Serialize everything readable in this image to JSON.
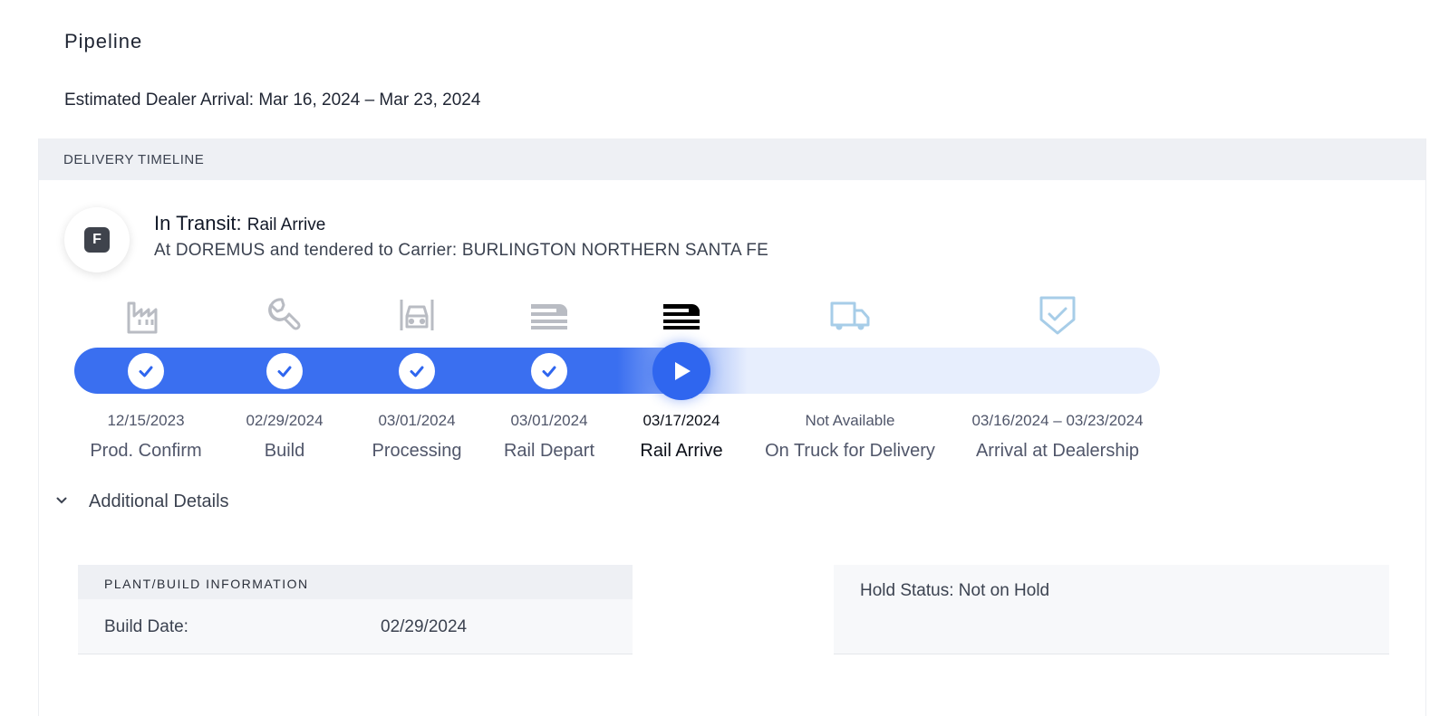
{
  "page": {
    "title": "Pipeline",
    "estimated_arrival": "Estimated Dealer Arrival: Mar 16, 2024 – Mar 23, 2024"
  },
  "timeline": {
    "header": "DELIVERY TIMELINE",
    "badge_letter": "F",
    "status_title": "In Transit:",
    "status_substep": "Rail Arrive",
    "status_description": "At DOREMUS and tendered to Carrier: BURLINGTON NORTHERN SANTA FE",
    "current_step_index": 4,
    "steps": [
      {
        "date": "12/15/2023",
        "label": "Prod. Confirm",
        "icon": "factory-icon",
        "state": "complete"
      },
      {
        "date": "02/29/2024",
        "label": "Build",
        "icon": "wrench-icon",
        "state": "complete"
      },
      {
        "date": "03/01/2024",
        "label": "Processing",
        "icon": "car-front-icon",
        "state": "complete"
      },
      {
        "date": "03/01/2024",
        "label": "Rail Depart",
        "icon": "train-icon",
        "state": "complete"
      },
      {
        "date": "03/17/2024",
        "label": "Rail Arrive",
        "icon": "train-icon",
        "state": "current"
      },
      {
        "date": "Not Available",
        "label": "On Truck for Delivery",
        "icon": "truck-icon",
        "state": "pending"
      },
      {
        "date": "03/16/2024 – 03/23/2024",
        "label": "Arrival at Dealership",
        "icon": "shield-check-icon",
        "state": "pending"
      }
    ],
    "colors": {
      "complete": "#3a6ff0",
      "pending": "#e7eefd",
      "icon_done": "#b9bcc3",
      "icon_current": "#000000",
      "icon_pending": "#a7cde8"
    }
  },
  "details": {
    "toggle_label": "Additional Details",
    "plant": {
      "header": "PLANT/BUILD INFORMATION",
      "build_date_label": "Build Date:",
      "build_date_value": "02/29/2024"
    },
    "hold": {
      "status_text": "Hold Status: Not on Hold"
    }
  }
}
